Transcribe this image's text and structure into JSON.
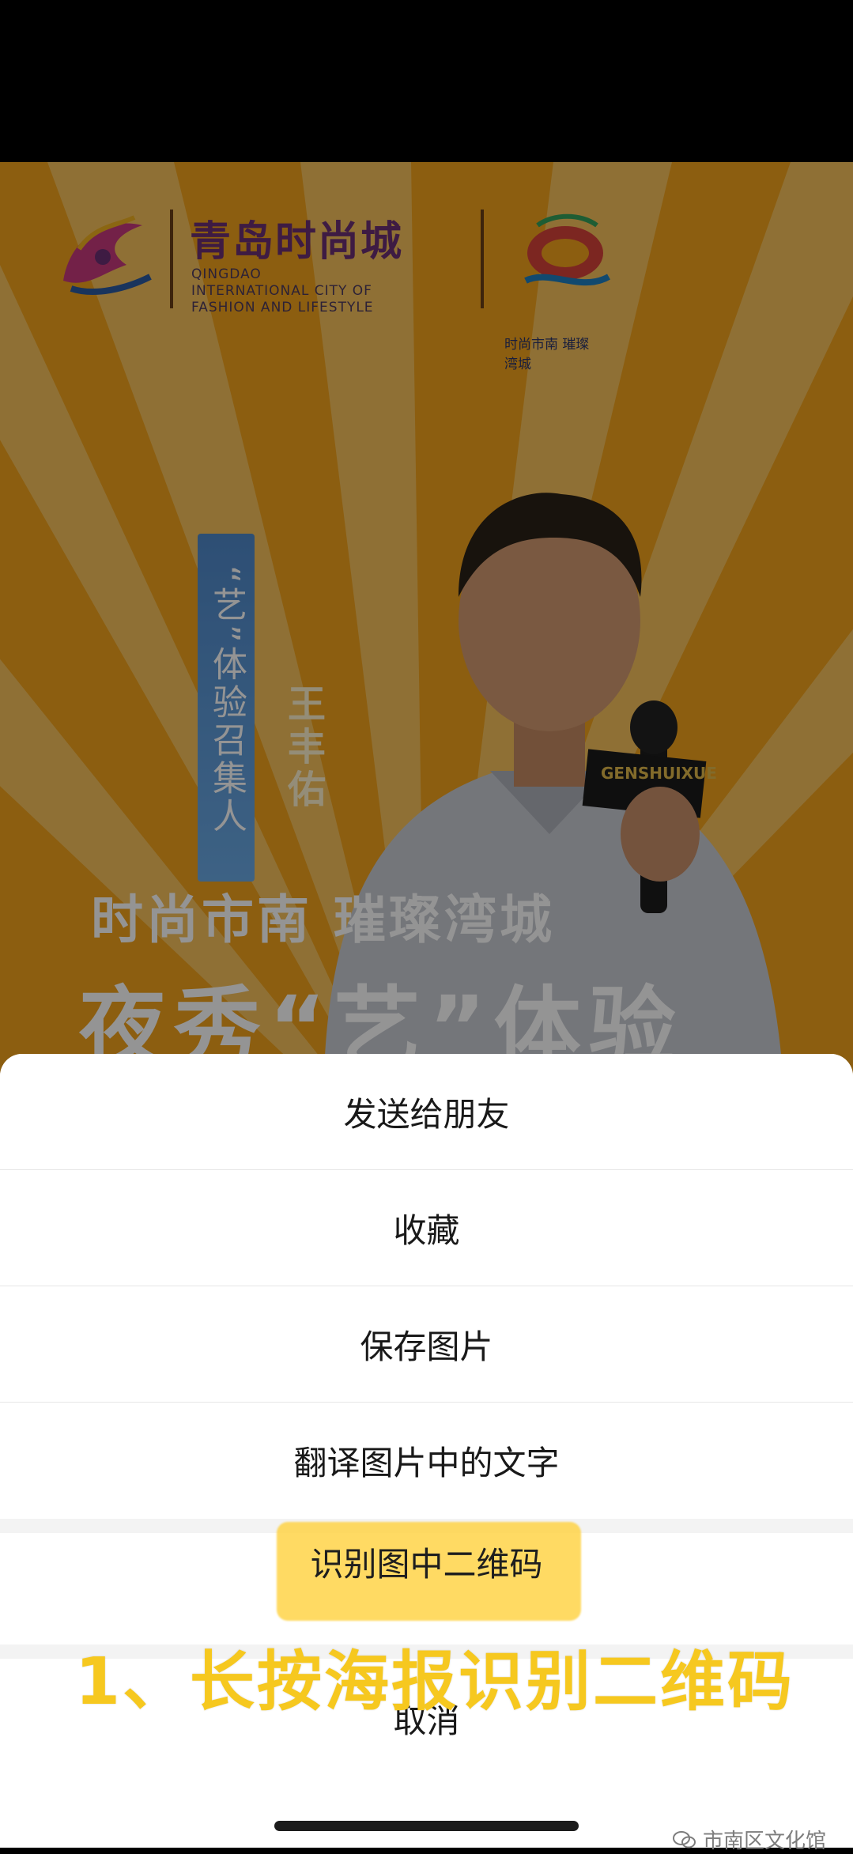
{
  "poster": {
    "logo_title": "青岛时尚城",
    "logo_subtitle_lines": [
      "QINGDAO",
      "INTERNATIONAL CITY OF",
      "FASHION AND LIFESTYLE"
    ],
    "logo_right_caption": "时尚市南  璀璨湾城",
    "banner_text": "“艺”体验召集人",
    "person_name": "王丰佑",
    "mic_brand": "GENSHUIXUE",
    "headline": "时尚市南 璀璨湾城",
    "headline_big": "夜秀“艺”体验"
  },
  "action_sheet": {
    "items": [
      {
        "label": "发送给朋友"
      },
      {
        "label": "收藏"
      },
      {
        "label": "保存图片"
      },
      {
        "label": "翻译图片中的文字"
      },
      {
        "label": "识别图中二维码"
      }
    ],
    "cancel_label": "取消"
  },
  "overlay_caption": "1、长按海报识别二维码",
  "watermark": "市南区文化馆",
  "colors": {
    "poster_bg": "#f2a21c",
    "highlight": "#ffd037",
    "caption": "#f6c81f",
    "banner": "#5a98d8"
  }
}
